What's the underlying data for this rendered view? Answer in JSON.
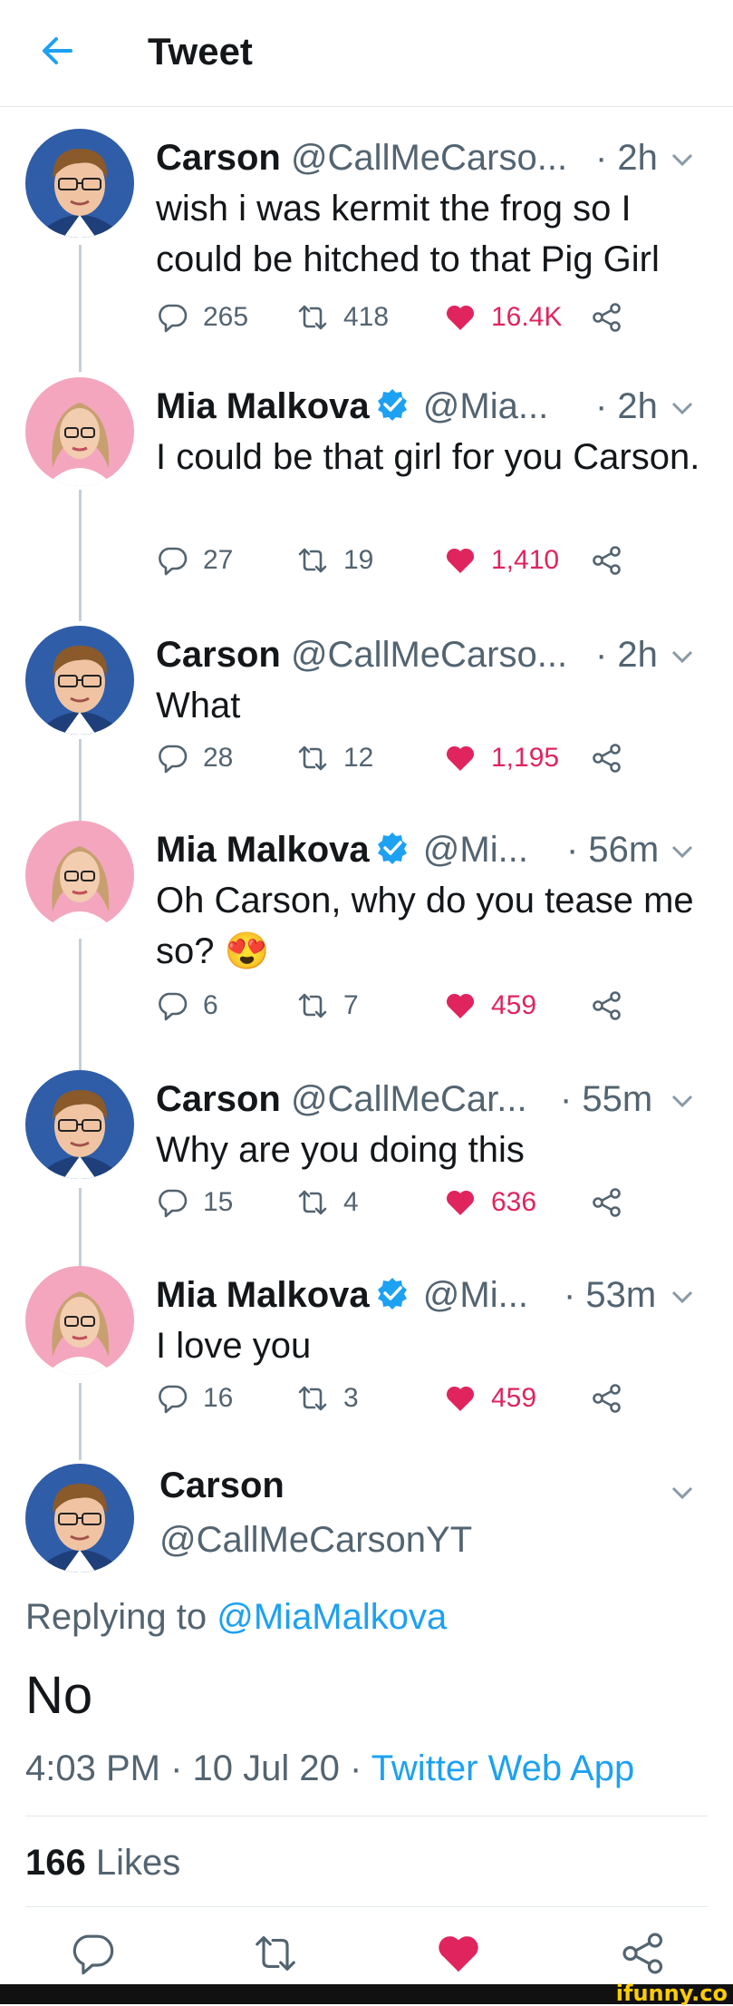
{
  "header": {
    "title": "Tweet",
    "back_icon": "arrow-left-icon"
  },
  "colors": {
    "accent": "#1da1f2",
    "like": "#e0245e",
    "verified": "#1da1f2",
    "muted": "#536471",
    "thread_line": "#c4cfd6"
  },
  "thread": [
    {
      "name": "Carson",
      "handle": "@CallMeCarso...",
      "time": "· 2h",
      "verified": false,
      "text": "wish i was kermit the frog so I could be hitched to that Pig Girl",
      "replies": "265",
      "retweets": "418",
      "likes": "16.4K"
    },
    {
      "name": "Mia Malkova",
      "handle": "@Mia...",
      "time": "· 2h",
      "verified": true,
      "text": "I could be that girl for you Carson.",
      "replies": "27",
      "retweets": "19",
      "likes": "1,410"
    },
    {
      "name": "Carson",
      "handle": "@CallMeCarso...",
      "time": "· 2h",
      "verified": false,
      "text": "What",
      "replies": "28",
      "retweets": "12",
      "likes": "1,195"
    },
    {
      "name": "Mia Malkova",
      "handle": "@Mi...",
      "time": "· 56m",
      "verified": true,
      "text": "Oh Carson, why do you tease me so? 😍",
      "replies": "6",
      "retweets": "7",
      "likes": "459"
    },
    {
      "name": "Carson",
      "handle": "@CallMeCar...",
      "time": "· 55m",
      "verified": false,
      "text": "Why are you doing this",
      "replies": "15",
      "retweets": "4",
      "likes": "636"
    },
    {
      "name": "Mia Malkova",
      "handle": "@Mi...",
      "time": "· 53m",
      "verified": true,
      "text": "I love you",
      "replies": "16",
      "retweets": "3",
      "likes": "459"
    }
  ],
  "main_tweet": {
    "name": "Carson",
    "handle": "@CallMeCarsonYT",
    "replying_prefix": "Replying to",
    "replying_to": "@MiaMalkova",
    "text": "No",
    "timestamp": "4:03 PM · 10 Jul 20 · ",
    "source": "Twitter Web App",
    "likes_count": "166",
    "likes_label": "Likes"
  },
  "watermark": "ifunny.co"
}
